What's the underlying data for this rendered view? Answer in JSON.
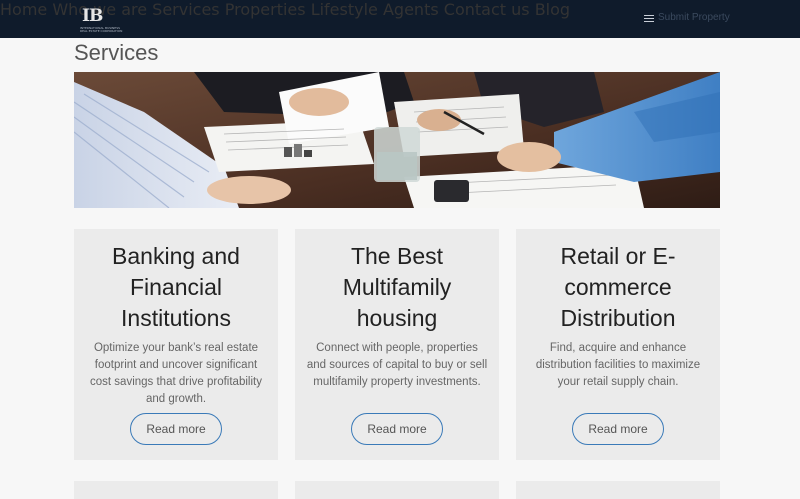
{
  "brand": {
    "logo_mark": "IB",
    "logo_text": "INTERNATIONAL BUSINESS REAL ESTATE CORPORATION"
  },
  "nav": {
    "items": [
      "Home",
      "Who we are",
      "Services",
      "Properties",
      "Lifestyle",
      "Agents",
      "Contact us",
      "Blog"
    ],
    "submit_label": "Submit Property"
  },
  "page": {
    "title": "Services"
  },
  "cards": [
    {
      "title": "Banking and Financial Institutions",
      "body": "Optimize your bank’s real estate footprint and uncover significant cost savings that drive profitability and growth.",
      "button": "Read more"
    },
    {
      "title": "The Best Multifamily housing",
      "body": "Connect with people, properties and sources of capital to buy or sell multifamily property investments.",
      "button": "Read more"
    },
    {
      "title": "Retail or E-commerce Distribution",
      "body": "Find, acquire and enhance distribution facilities to maximize your retail supply chain.",
      "button": "Read more"
    }
  ],
  "colors": {
    "nav_bg": "#0f1b2b",
    "page_bg": "#f7f7f7",
    "card_bg": "#ebebeb",
    "button_border": "#3a7ab8"
  }
}
